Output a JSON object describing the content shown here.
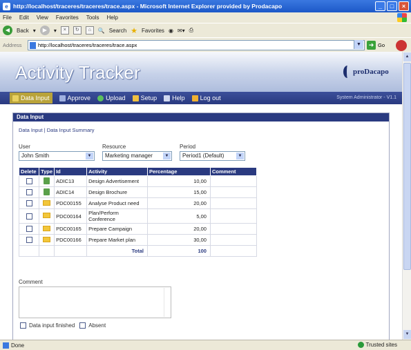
{
  "window": {
    "title": "http://localhost/traceres/traceres/trace.aspx - Microsoft Internet Explorer provided by Prodacapo"
  },
  "menu": [
    "File",
    "Edit",
    "View",
    "Favorites",
    "Tools",
    "Help"
  ],
  "toolbar": {
    "back_label": "Back",
    "search_label": "Search",
    "favorites_label": "Favorites"
  },
  "address": {
    "label": "Address",
    "url": "http://localhost/traceres/traceres/trace.aspx",
    "go_label": "Go"
  },
  "app": {
    "title": "Activity Tracker",
    "logo_text": "proDacapo",
    "status": "System Administrator - V1.1"
  },
  "nav": [
    {
      "label": "Data Input",
      "icon": "pencil-icon",
      "active": true
    },
    {
      "label": "Approve",
      "icon": "approve-icon"
    },
    {
      "label": "Upload",
      "icon": "upload-icon"
    },
    {
      "label": "Setup",
      "icon": "setup-icon"
    },
    {
      "label": "Help",
      "icon": "help-icon"
    },
    {
      "label": "Log out",
      "icon": "logout-icon"
    }
  ],
  "panel": {
    "title": "Data Input",
    "link_data_input": "Data Input",
    "link_separator": "|",
    "link_summary": "Data Input Summary"
  },
  "filters": {
    "user_label": "User",
    "user_value": "John Smith",
    "resource_label": "Resource",
    "resource_value": "Marketing manager",
    "period_label": "Period",
    "period_value": "Period1 (Default)"
  },
  "table": {
    "headers": [
      "Delete",
      "Type",
      "Id",
      "Activity",
      "Percentage",
      "Comment"
    ],
    "rows": [
      {
        "type": "book-icon",
        "id": "ADIC13",
        "activity": "Design Advertisement",
        "percentage": "10,00"
      },
      {
        "type": "book-icon",
        "id": "ADIC14",
        "activity": "Design Brochure",
        "percentage": "15,00"
      },
      {
        "type": "folder-icon",
        "id": "PDC00155",
        "activity": "Analyse Product need",
        "percentage": "20,00"
      },
      {
        "type": "folder-icon",
        "id": "PDC00164",
        "activity": "Plan/Perform Conference",
        "percentage": "5,00"
      },
      {
        "type": "folder-icon",
        "id": "PDC00165",
        "activity": "Prepare Campaign",
        "percentage": "20,00"
      },
      {
        "type": "folder-icon",
        "id": "PDC00166",
        "activity": "Prepare Market plan",
        "percentage": "30,00"
      }
    ],
    "total_label": "Total",
    "total_value": "100"
  },
  "comment": {
    "label": "Comment",
    "value": ""
  },
  "options": {
    "finished_label": "Data input finished",
    "absent_label": "Absent"
  },
  "statusbar": {
    "left": "Done",
    "zone": "Trusted sites"
  }
}
